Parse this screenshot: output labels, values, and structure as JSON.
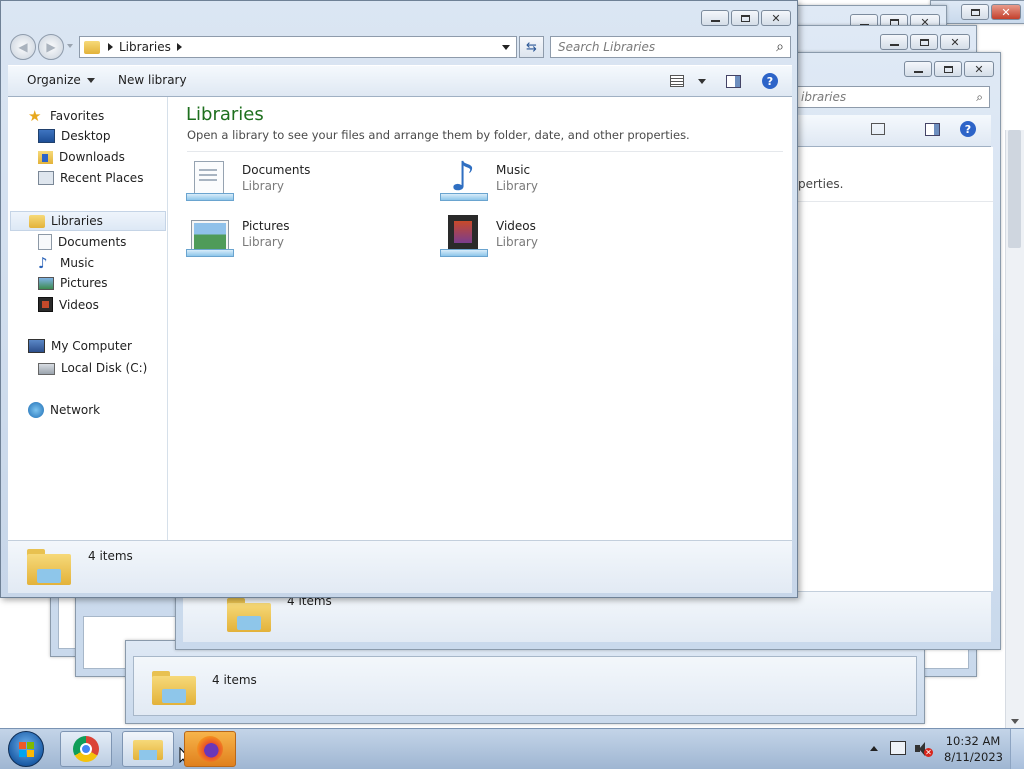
{
  "main": {
    "address": [
      "Libraries"
    ],
    "search_placeholder": "Search Libraries",
    "toolbar": {
      "organize": "Organize",
      "new_library": "New library"
    },
    "nav": {
      "favorites": "Favorites",
      "favorites_items": [
        "Desktop",
        "Downloads",
        "Recent Places"
      ],
      "libraries": "Libraries",
      "libraries_items": [
        "Documents",
        "Music",
        "Pictures",
        "Videos"
      ],
      "computer": "My Computer",
      "computer_items": [
        "Local Disk (C:)"
      ],
      "network": "Network"
    },
    "content": {
      "title": "Libraries",
      "subtitle": "Open a library to see your files and arrange them by folder, date, and other properties.",
      "items": [
        {
          "name": "Documents",
          "type": "Library"
        },
        {
          "name": "Music",
          "type": "Library"
        },
        {
          "name": "Pictures",
          "type": "Library"
        },
        {
          "name": "Videos",
          "type": "Library"
        }
      ]
    },
    "status": "4 items"
  },
  "background": {
    "search_partial": "ibraries",
    "subtitle_partial": "perties.",
    "status_a": "4 items",
    "status_b": "4 items"
  },
  "taskbar": {
    "time": "10:32 AM",
    "date": "8/11/2023",
    "apps": [
      "start-orb-icon",
      "chrome-icon",
      "explorer-icon",
      "firefox-icon"
    ]
  },
  "colors": {
    "title_green": "#1e6f1e",
    "link_blue": "#1a3d8f"
  }
}
